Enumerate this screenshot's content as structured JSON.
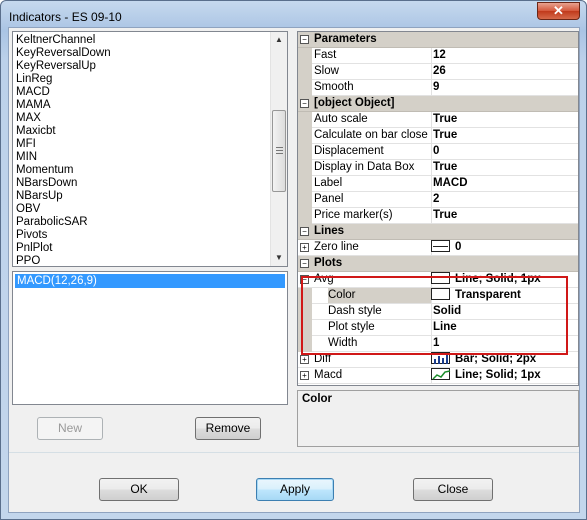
{
  "window": {
    "title": "Indicators - ES 09-10",
    "close_label": "✕"
  },
  "indicator_list": {
    "items": [
      "KeltnerChannel",
      "KeyReversalDown",
      "KeyReversalUp",
      "LinReg",
      "MACD",
      "MAMA",
      "MAX",
      "Maxicbt",
      "MFI",
      "MIN",
      "Momentum",
      "NBarsDown",
      "NBarsUp",
      "OBV",
      "ParabolicSAR",
      "Pivots",
      "PnlPlot",
      "PPO"
    ]
  },
  "applied_list": {
    "items": [
      "MACD(12,26,9)"
    ]
  },
  "left_buttons": {
    "new_label": "New",
    "remove_label": "Remove"
  },
  "properties": {
    "parameters": {
      "label": "Parameters",
      "fast": {
        "name": "Fast",
        "value": "12"
      },
      "slow": {
        "name": "Slow",
        "value": "26"
      },
      "smooth": {
        "name": "Smooth",
        "value": "9"
      }
    },
    "general": {
      "label": {
        "name": "Label",
        "value": "MACD"
      },
      "auto_scale": {
        "name": "Auto scale",
        "value": "True"
      },
      "calculate_on_bar_close": {
        "name": "Calculate on bar close",
        "value": "True"
      },
      "displacement": {
        "name": "Displacement",
        "value": "0"
      },
      "display_in_data_box": {
        "name": "Display in Data Box",
        "value": "True"
      },
      "panel": {
        "name": "Panel",
        "value": "2"
      },
      "price_marker": {
        "name": "Price marker(s)",
        "value": "True"
      }
    },
    "lines": {
      "label": "Lines",
      "zero_line": {
        "name": "Zero line",
        "value": "0"
      }
    },
    "plots": {
      "label": "Plots",
      "avg": {
        "name": "Avg",
        "value": "Line; Solid; 1px",
        "color": {
          "name": "Color",
          "value": "Transparent"
        },
        "dash_style": {
          "name": "Dash style",
          "value": "Solid"
        },
        "plot_style": {
          "name": "Plot style",
          "value": "Line"
        },
        "width": {
          "name": "Width",
          "value": "1"
        }
      },
      "diff": {
        "name": "Diff",
        "value": "Bar; Solid; 2px"
      },
      "macd": {
        "name": "Macd",
        "value": "Line; Solid; 1px"
      }
    }
  },
  "description": {
    "label": "Color"
  },
  "dialog_buttons": {
    "ok_label": "OK",
    "apply_label": "Apply",
    "close_label": "Close"
  },
  "colors": {
    "selection": "#3399ff",
    "highlight_box": "#d01818",
    "category_bg": "#d4d0c8"
  },
  "expand_glyphs": {
    "collapsed": "+",
    "expanded": "−"
  }
}
